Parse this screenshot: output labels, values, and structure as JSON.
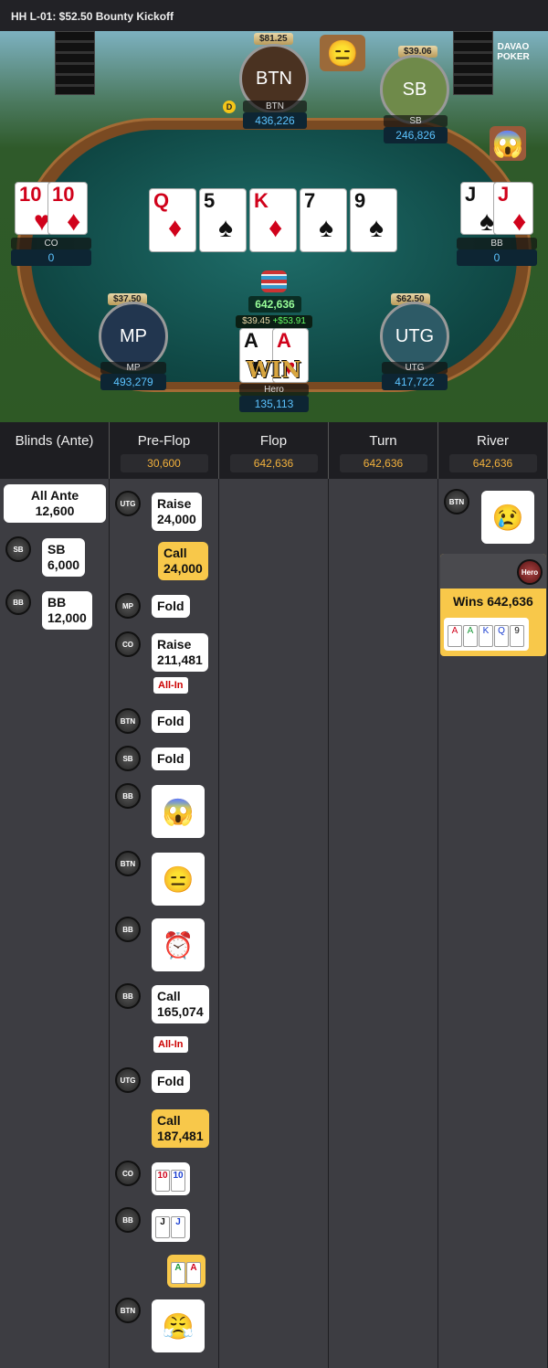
{
  "title": "HH  L-01: $52.50 Bounty Kickoff",
  "brand": "DAVAO POKER",
  "pot": "642,636",
  "board": [
    {
      "rank": "Q",
      "suit": "♦",
      "color": "red"
    },
    {
      "rank": "5",
      "suit": "♠",
      "color": "blk"
    },
    {
      "rank": "K",
      "suit": "♦",
      "color": "red"
    },
    {
      "rank": "7",
      "suit": "♠",
      "color": "blk"
    },
    {
      "rank": "9",
      "suit": "♠",
      "color": "blk"
    }
  ],
  "seats": {
    "btn": {
      "label": "BTN",
      "name": "BTN",
      "chips": "436,226",
      "bounty": "$81.25"
    },
    "sb": {
      "label": "SB",
      "name": "SB",
      "chips": "246,826",
      "bounty": "$39.06"
    },
    "co": {
      "name": "CO",
      "chips": "0"
    },
    "bb": {
      "name": "BB",
      "chips": "0"
    },
    "mp": {
      "label": "MP",
      "name": "MP",
      "chips": "493,279",
      "bounty": "$37.50"
    },
    "utg": {
      "label": "UTG",
      "name": "UTG",
      "chips": "417,722",
      "bounty": "$62.50"
    },
    "hero": {
      "name": "Hero",
      "chips": "135,113",
      "bounty": "$39.45",
      "gain": "+$53.91",
      "win": "WIN"
    }
  },
  "cards": {
    "co": [
      "10",
      "10"
    ],
    "bb": [
      "J",
      "J"
    ],
    "hero": [
      "A",
      "A"
    ]
  },
  "columns": [
    {
      "title": "Blinds (Ante)",
      "pot": ""
    },
    {
      "title": "Pre-Flop",
      "pot": "30,600"
    },
    {
      "title": "Flop",
      "pot": "642,636"
    },
    {
      "title": "Turn",
      "pot": "642,636"
    },
    {
      "title": "River",
      "pot": "642,636"
    }
  ],
  "blinds": {
    "ante_l1": "All Ante",
    "ante_l2": "12,600",
    "sb_badge": "SB",
    "sb_l1": "SB",
    "sb_l2": "6,000",
    "bb_badge": "BB",
    "bb_l1": "BB",
    "bb_l2": "12,000"
  },
  "preflop": [
    {
      "badge": "UTG",
      "l1": "Raise",
      "l2": "24,000"
    },
    {
      "l1": "Call",
      "l2": "24,000"
    },
    {
      "badge": "MP",
      "l1": "Fold"
    },
    {
      "badge": "CO",
      "l1": "Raise",
      "l2": "211,481",
      "allin": "All-In"
    },
    {
      "badge": "BTN",
      "l1": "Fold"
    },
    {
      "badge": "SB",
      "l1": "Fold"
    },
    {
      "badge": "BB"
    },
    {
      "badge": "BTN"
    },
    {
      "badge": "BB"
    },
    {
      "badge": "BB",
      "l1": "Call",
      "l2": "165,074",
      "allin": "All-In"
    },
    {
      "badge": "UTG",
      "l1": "Fold"
    },
    {
      "l1": "Call",
      "l2": "187,481"
    },
    {
      "badge": "CO"
    },
    {
      "badge": "BB"
    },
    {
      "badge": "BTN"
    }
  ],
  "river": {
    "btn_badge": "BTN",
    "hero_badge": "Hero",
    "wins": "Wins 642,636"
  }
}
